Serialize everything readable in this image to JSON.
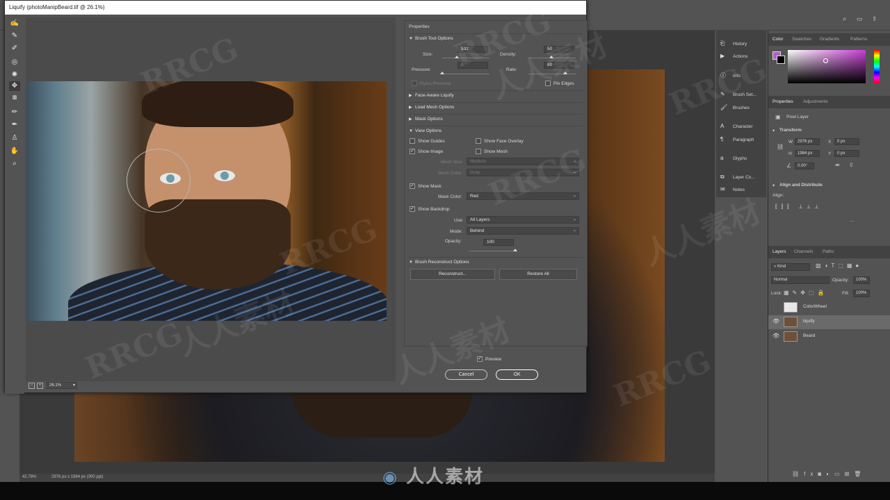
{
  "liquify": {
    "title": "Liquify (photoManipBeard.tif @ 26.1%)",
    "zoom": "26.1%",
    "properties": {
      "title": "Properties",
      "brush_tool_options": {
        "label": "Brush Tool Options",
        "size_label": "Size:",
        "size": "532",
        "density_label": "Density:",
        "density": "50",
        "pressure_label": "Pressure:",
        "pressure": "1",
        "rate_label": "Rate:",
        "rate": "80",
        "stylus_pressure": "Stylus Pressure",
        "pin_edges": "Pin Edges"
      },
      "face_aware_liquify": "Face-Aware Liquify",
      "load_mesh_options": "Load Mesh Options",
      "mask_options": "Mask Options",
      "view_options": {
        "label": "View Options",
        "show_guides": "Show Guides",
        "show_face_overlay": "Show Face Overlay",
        "show_image": "Show Image",
        "show_mesh": "Show Mesh",
        "mesh_size_label": "Mesh Size:",
        "mesh_size": "Medium",
        "mesh_color_label": "Mesh Color:",
        "mesh_color": "Gray",
        "show_mask": "Show Mask",
        "mask_color_label": "Mask Color:",
        "mask_color": "Red",
        "show_backdrop": "Show Backdrop",
        "use_label": "Use:",
        "use": "All Layers",
        "mode_label": "Mode:",
        "mode": "Behind",
        "opacity_label": "Opacity:",
        "opacity": "100"
      },
      "brush_reconstruct_options": {
        "label": "Brush Reconstruct Options",
        "reconstruct": "Reconstruct...",
        "restore_all": "Restore All"
      }
    },
    "preview_label": "Preview",
    "cancel": "Cancel",
    "ok": "OK"
  },
  "right_strip": {
    "items": [
      "History",
      "Actions",
      "Info",
      "Brush Set...",
      "Brushes",
      "Character",
      "Paragraph",
      "Glyphs",
      "Layer Co...",
      "Notes"
    ]
  },
  "color_panel": {
    "tabs": [
      "Color",
      "Swatches",
      "Gradients",
      "Patterns"
    ],
    "foreground": "#b45fc8"
  },
  "properties_panel": {
    "tabs": [
      "Properties",
      "Adjustments"
    ],
    "layer_type": "Pixel Layer",
    "transform_label": "Transform",
    "w_label": "W",
    "w": "2976 px",
    "x_label": "X",
    "x": "0 px",
    "h_label": "H",
    "h": "1984 px",
    "y_label": "Y",
    "y": "0 px",
    "angle": "0.00°",
    "align_label": "Align and Distribute",
    "align_sub": "Align:",
    "more": "..."
  },
  "layers_panel": {
    "tabs": [
      "Layers",
      "Channels",
      "Paths"
    ],
    "kind": "Kind",
    "blend_mode": "Normal",
    "opacity_label": "Opacity:",
    "opacity": "100%",
    "lock_label": "Lock:",
    "fill_label": "Fill:",
    "fill": "100%",
    "layers": [
      {
        "name": "ColorWheel",
        "visible": false
      },
      {
        "name": "liquify",
        "visible": true
      },
      {
        "name": "Beard",
        "visible": true
      }
    ]
  },
  "status_bar": {
    "zoom": "42.78%",
    "doc_info": "2976 px x 1984 px (300 ppi)"
  },
  "watermark": {
    "text": "RRCG",
    "cn": "人人素材"
  }
}
